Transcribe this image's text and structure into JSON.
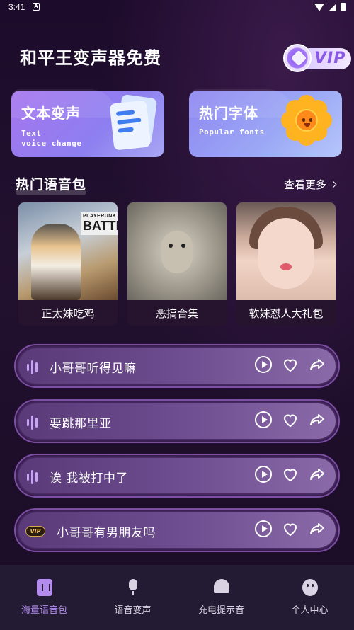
{
  "status": {
    "time": "3:41",
    "notif_glyph": "A"
  },
  "header": {
    "title": "和平王变声器免费",
    "vip_label": "VIP"
  },
  "features": [
    {
      "title": "文本变声",
      "sub_line1": "Text",
      "sub_line2": "voice change",
      "icon": "document-icon"
    },
    {
      "title": "热门字体",
      "sub_line1": "Popular fonts",
      "sub_line2": "",
      "icon": "sunflower-icon"
    }
  ],
  "hot_packs": {
    "title": "热门语音包",
    "see_more": "查看更多",
    "items": [
      {
        "label": "正太妹吃鸡",
        "thumb": "pubg-character",
        "thumb_text": "BATTLEG",
        "thumb_small": "PLAYERUNK"
      },
      {
        "label": "恶搞合集",
        "thumb": "sheep"
      },
      {
        "label": "软妹怼人大礼包",
        "thumb": "girl-pouting"
      }
    ]
  },
  "voice_list": [
    {
      "label": "小哥哥听得见嘛",
      "vip": false
    },
    {
      "label": "要跳那里亚",
      "vip": false
    },
    {
      "label": "诶 我被打中了",
      "vip": false
    },
    {
      "label": "小哥哥有男朋友吗",
      "vip": true,
      "vip_tag": "VIP"
    }
  ],
  "tabs": [
    {
      "label": "海量语音包",
      "icon": "voice-pack-icon",
      "active": true
    },
    {
      "label": "语音变声",
      "icon": "microphone-icon",
      "active": false
    },
    {
      "label": "充电提示音",
      "icon": "bell-icon",
      "active": false
    },
    {
      "label": "个人中心",
      "icon": "smiley-icon",
      "active": false
    }
  ],
  "colors": {
    "accent": "#b48cf0",
    "vip_gold": "#f0c060",
    "background": "#1c0b2a"
  }
}
